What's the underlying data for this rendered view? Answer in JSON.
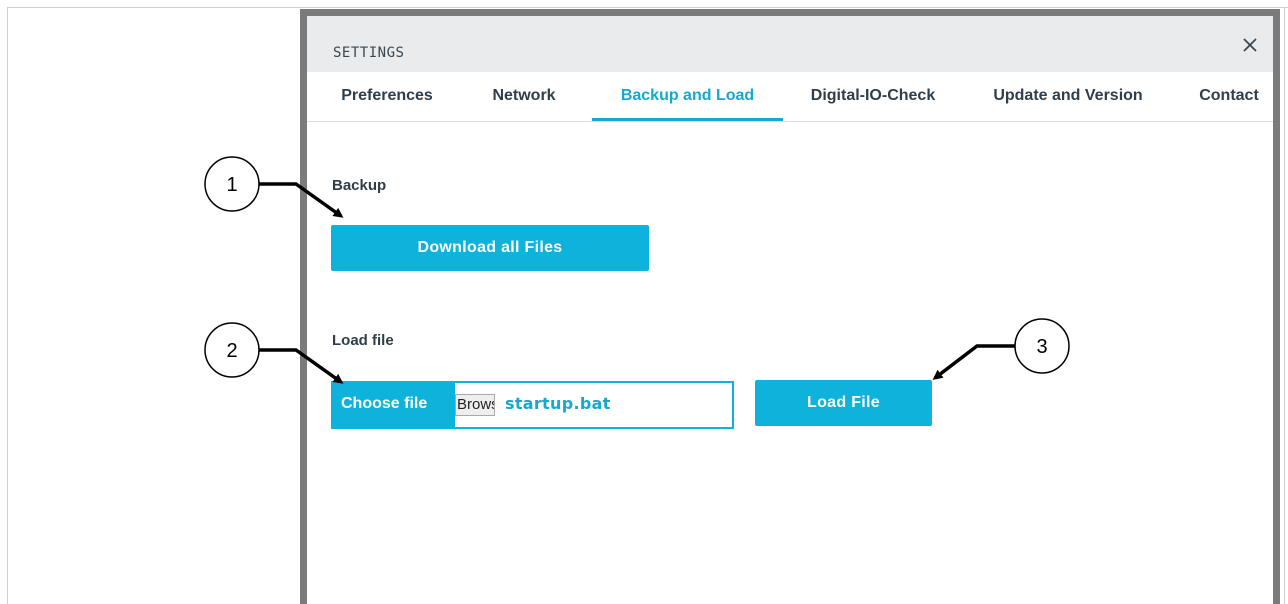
{
  "dialog": {
    "title": "SETTINGS",
    "close_icon": "close-icon"
  },
  "tabs": [
    {
      "label": "Preferences"
    },
    {
      "label": "Network"
    },
    {
      "label": "Backup and Load",
      "active": true
    },
    {
      "label": "Digital-IO-Check"
    },
    {
      "label": "Update and Version"
    },
    {
      "label": "Contact"
    }
  ],
  "backup": {
    "section_label": "Backup",
    "download_button": "Download all Files"
  },
  "load": {
    "section_label": "Load file",
    "choose_button": "Choose file",
    "native_browse": "Brows…",
    "file_name": "startup.bat",
    "load_button": "Load File"
  },
  "callouts": [
    "1",
    "2",
    "3"
  ],
  "colors": {
    "accent": "#0eb3dc",
    "dialog_border": "#7b7b7b",
    "header_bg": "#e9ebec"
  }
}
